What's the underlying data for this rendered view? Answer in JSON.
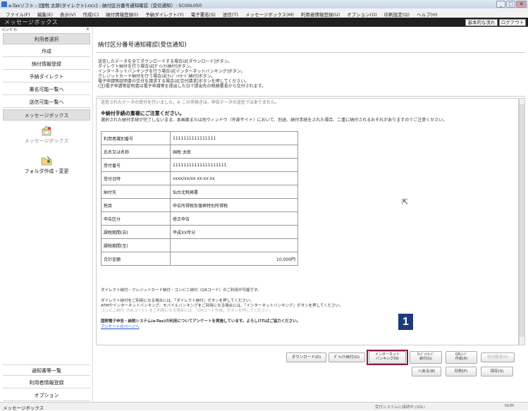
{
  "window": {
    "title": "e-Taxソフト - [国税  太郎(ダイレクト).ncc] - 納付区分番号通知確認（受信通知）: SC00L050",
    "controls": [
      "_",
      "□",
      "✕"
    ]
  },
  "menu": [
    "ファイル(F)",
    "編集(E)",
    "表示(V)",
    "作成(C)",
    "納付情報登録(I)",
    "予納ダイレクト(Y)",
    "電子署名(S)",
    "送信(T)",
    "メッセージボックス(M)",
    "利用者情報登録(U)",
    "オプション(O)",
    "印刷設定(Q)",
    "ヘルプ(H)"
  ],
  "band": {
    "title": "メッセージボックス",
    "buttons": [
      "基本的な流れ",
      "ログアウト"
    ]
  },
  "sidebar": {
    "header": "ﾒﾆｭｰﾎﾞﾀﾝ",
    "close": "×",
    "items": [
      "利用者選択",
      "作成",
      "納付情報登録",
      "予納ダイレクト",
      "署名可能一覧へ",
      "送信可能一覧へ",
      "メッセージボックス"
    ],
    "icon_items": [
      {
        "label": "メッセージボックス",
        "icon": "mailbox-icon"
      },
      {
        "label": "フォルダ作成・変更",
        "icon": "folder-icon"
      }
    ],
    "bottom_items": [
      "通知書等一覧",
      "利用者情報登録",
      "オプション"
    ]
  },
  "main": {
    "title": "納付区分番号通知確認(受信通知)",
    "instructions": [
      "送信したデータを全てダウンロードする場合は[ダウンロード]ボタン。",
      "ダイレクト納付を行う場合は[ﾀﾞｲﾚｸﾄ納付]ボタン。",
      "インターネットバンキングを行う場合は[インターネットバンキング]ボタン。",
      "クレジットカード納付を行う場合は[ｸﾚｼﾞｯﾄｶｰﾄﾞ納付]ボタン。",
      "電子申請等証明書の交付を請求する場合は[交付請求]ボタンを押してください。",
      "(注)電子申請等証明書は電子申請等を提出した日で提出先の税務署長から交付されます。"
    ],
    "cut_line": "送信されたデータの受付を行いました。※ この手続きは、申告データの送信ではありません。",
    "warning_title": "※納付手続の重複にご注意ください。",
    "warning_body": "選択された納付手続が完了しないまま、本画面または別ウィンドウ（外部サイト）において、別途、納付手続をされた場合、二重に納付されるおそれがありますのでご注意ください。",
    "table": [
      {
        "k": "利用者識別番号",
        "v": "1111111111111111"
      },
      {
        "k": "氏名又は名称",
        "v": "国税  太郎"
      },
      {
        "k": "受付番号",
        "v": "11111111111111111111"
      },
      {
        "k": "受付日時",
        "v": "xxxx/xx/xx  xx:xx:xx"
      },
      {
        "k": "納付先",
        "v": "仙台北税務署"
      },
      {
        "k": "税目",
        "v": "申告所得税及復興特別所得税"
      },
      {
        "k": "申告区分",
        "v": "修正申告"
      },
      {
        "k": "課税期間(自)",
        "v": "平成XX年分"
      },
      {
        "k": "課税期間(至)",
        "v": ""
      },
      {
        "k": "合計金額",
        "v": "10,000円"
      }
    ],
    "note1": "ダイレクト納付・クレジットカード納付・コンビニ納付（QRコード）のご利用が可能です。",
    "note2": [
      "ダイレクト納付をご利用になる場合には、「ダイレクト納付」ボタンを押してください。",
      "ATMやインターネットバンキング、モバイルバンキングをご利用になる場合には、「インターネットバンキング」ボタンを押してください。",
      "コンビニ納付（QRコード）をご利用になる場合には、「QRコード作成」ボタンを押してください。"
    ],
    "survey": "国税電子申告・納税システム(e-Tax)の利用についてアンケートを実施しています。よろしければご協力ください。",
    "survey_link": "アンケートのページへ",
    "buttons_row1": [
      {
        "label": "ダウンロード(D)"
      },
      {
        "label": "ﾀﾞｲﾚｸﾄ納付(G)"
      },
      {
        "label": "インターネット\nバンキング(N)"
      },
      {
        "label": "ｸﾚｼﾞｯﾄｶｰﾄﾞ\n納付(G)"
      },
      {
        "label": "QRｺｰﾄﾞ\n作成(R)"
      },
      {
        "label": "交付請求(K)"
      }
    ],
    "buttons_row2": [
      "＜戻る(B)",
      "印刷(P)",
      "保存(S)"
    ],
    "badge": "1"
  },
  "status": {
    "left": "メッセージボックス",
    "right": "受付システムに接続中 (SSL)",
    "num": "NUM"
  }
}
